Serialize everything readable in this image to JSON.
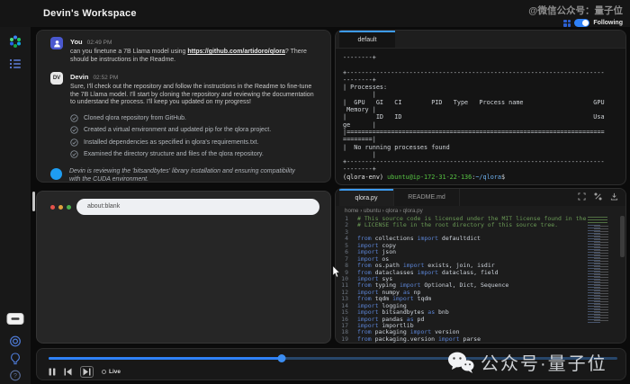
{
  "top_bar": {
    "title": "Devin's Workspace",
    "watermark": "@微信公众号：量子位",
    "following_label": "Following"
  },
  "colors": {
    "accent_blue": "#2f81f7",
    "status_dot": "#1e9df2",
    "prompt_user_green": "#57c443",
    "prompt_path_blue": "#6fb3f2",
    "comment_green": "#6a9955",
    "keyword_blue": "#5c85d6"
  },
  "chat": {
    "user_message": {
      "sender": "You",
      "time": "02:49 PM",
      "text_before_link": "can you finetune a 7B Llama model using ",
      "link": "https://github.com/artidoro/qlora",
      "text_after_link": "? There should be instructions in the Readme."
    },
    "devin_message": {
      "sender": "Devin",
      "avatar_initials": "DV",
      "time": "02:52 PM",
      "text": "Sure, I'll check out the repository and follow the instructions in the Readme to fine-tune the 7B Llama model. I'll start by cloning the repository and reviewing the documentation to understand the process. I'll keep you updated on my progress!"
    },
    "checklist": [
      "Cloned qlora repository from GitHub.",
      "Created a virtual environment and updated pip for the qlora project.",
      "Installed dependencies as specified in qlora's requirements.txt.",
      "Examined the directory structure and files of the qlora repository."
    ],
    "status": "Devin is reviewing the 'bitsandbytes' library installation and ensuring compatibility with the CUDA environment."
  },
  "browser": {
    "url": "about:blank"
  },
  "terminal": {
    "tab": "default",
    "output": "--------+\n\n+----------------------------------------------------------------------\n--------+\n| Processes:\n        |\n|  GPU   GI   CI        PID   Type   Process name                   GPU\n Memory |\n|        ID   ID                                                    Usa\nge      |\n|======================================================================\n========|\n|  No running processes found\n        |\n+----------------------------------------------------------------------\n--------+",
    "prompt": {
      "env": "(qlora-env) ",
      "user_host": "ubuntu@ip-172-31-22-136",
      "colon": ":",
      "path": "~/qlora",
      "dollar": "$"
    }
  },
  "editor": {
    "tabs": [
      "qlora.py",
      "README.md"
    ],
    "breadcrumb": "home › ubuntu › qlora › qlora.py",
    "code_lines": [
      {
        "n": "1",
        "tokens": [
          [
            "c",
            "# This source code is licensed under the MIT license found in the"
          ]
        ]
      },
      {
        "n": "2",
        "tokens": [
          [
            "c",
            "# LICENSE file in the root directory of this source tree."
          ]
        ]
      },
      {
        "n": "3",
        "tokens": []
      },
      {
        "n": "4",
        "tokens": [
          [
            "k",
            "from"
          ],
          [
            "i",
            " collections "
          ],
          [
            "k",
            "import"
          ],
          [
            "i",
            " defaultdict"
          ]
        ]
      },
      {
        "n": "5",
        "tokens": [
          [
            "k",
            "import"
          ],
          [
            "i",
            " copy"
          ]
        ]
      },
      {
        "n": "6",
        "tokens": [
          [
            "k",
            "import"
          ],
          [
            "i",
            " json"
          ]
        ]
      },
      {
        "n": "7",
        "tokens": [
          [
            "k",
            "import"
          ],
          [
            "i",
            " os"
          ]
        ]
      },
      {
        "n": "8",
        "tokens": [
          [
            "k",
            "from"
          ],
          [
            "i",
            " os.path "
          ],
          [
            "k",
            "import"
          ],
          [
            "i",
            " exists, join, isdir"
          ]
        ]
      },
      {
        "n": "9",
        "tokens": [
          [
            "k",
            "from"
          ],
          [
            "i",
            " dataclasses "
          ],
          [
            "k",
            "import"
          ],
          [
            "i",
            " dataclass, field"
          ]
        ]
      },
      {
        "n": "10",
        "tokens": [
          [
            "k",
            "import"
          ],
          [
            "i",
            " sys"
          ]
        ]
      },
      {
        "n": "11",
        "tokens": [
          [
            "k",
            "from"
          ],
          [
            "i",
            " typing "
          ],
          [
            "k",
            "import"
          ],
          [
            "i",
            " Optional, Dict, Sequence"
          ]
        ]
      },
      {
        "n": "12",
        "tokens": [
          [
            "k",
            "import"
          ],
          [
            "i",
            " numpy "
          ],
          [
            "k",
            "as"
          ],
          [
            "i",
            " np"
          ]
        ]
      },
      {
        "n": "13",
        "tokens": [
          [
            "k",
            "from"
          ],
          [
            "i",
            " tqdm "
          ],
          [
            "k",
            "import"
          ],
          [
            "i",
            " tqdm"
          ]
        ]
      },
      {
        "n": "14",
        "tokens": [
          [
            "k",
            "import"
          ],
          [
            "i",
            " logging"
          ]
        ]
      },
      {
        "n": "15",
        "tokens": [
          [
            "k",
            "import"
          ],
          [
            "i",
            " bitsandbytes "
          ],
          [
            "k",
            "as"
          ],
          [
            "i",
            " bnb"
          ]
        ]
      },
      {
        "n": "16",
        "tokens": [
          [
            "k",
            "import"
          ],
          [
            "i",
            " pandas "
          ],
          [
            "k",
            "as"
          ],
          [
            "i",
            " pd"
          ]
        ]
      },
      {
        "n": "17",
        "tokens": [
          [
            "k",
            "import"
          ],
          [
            "i",
            " importlib"
          ]
        ]
      },
      {
        "n": "18",
        "tokens": [
          [
            "k",
            "from"
          ],
          [
            "i",
            " packaging "
          ],
          [
            "k",
            "import"
          ],
          [
            "i",
            " version"
          ]
        ]
      },
      {
        "n": "19",
        "tokens": [
          [
            "k",
            "from"
          ],
          [
            "i",
            " packaging.version "
          ],
          [
            "k",
            "import"
          ],
          [
            "i",
            " parse"
          ]
        ]
      }
    ]
  },
  "playback": {
    "live_label": "Live",
    "progress_percent": 41
  },
  "watermark_bottom": "公众号·量子位"
}
